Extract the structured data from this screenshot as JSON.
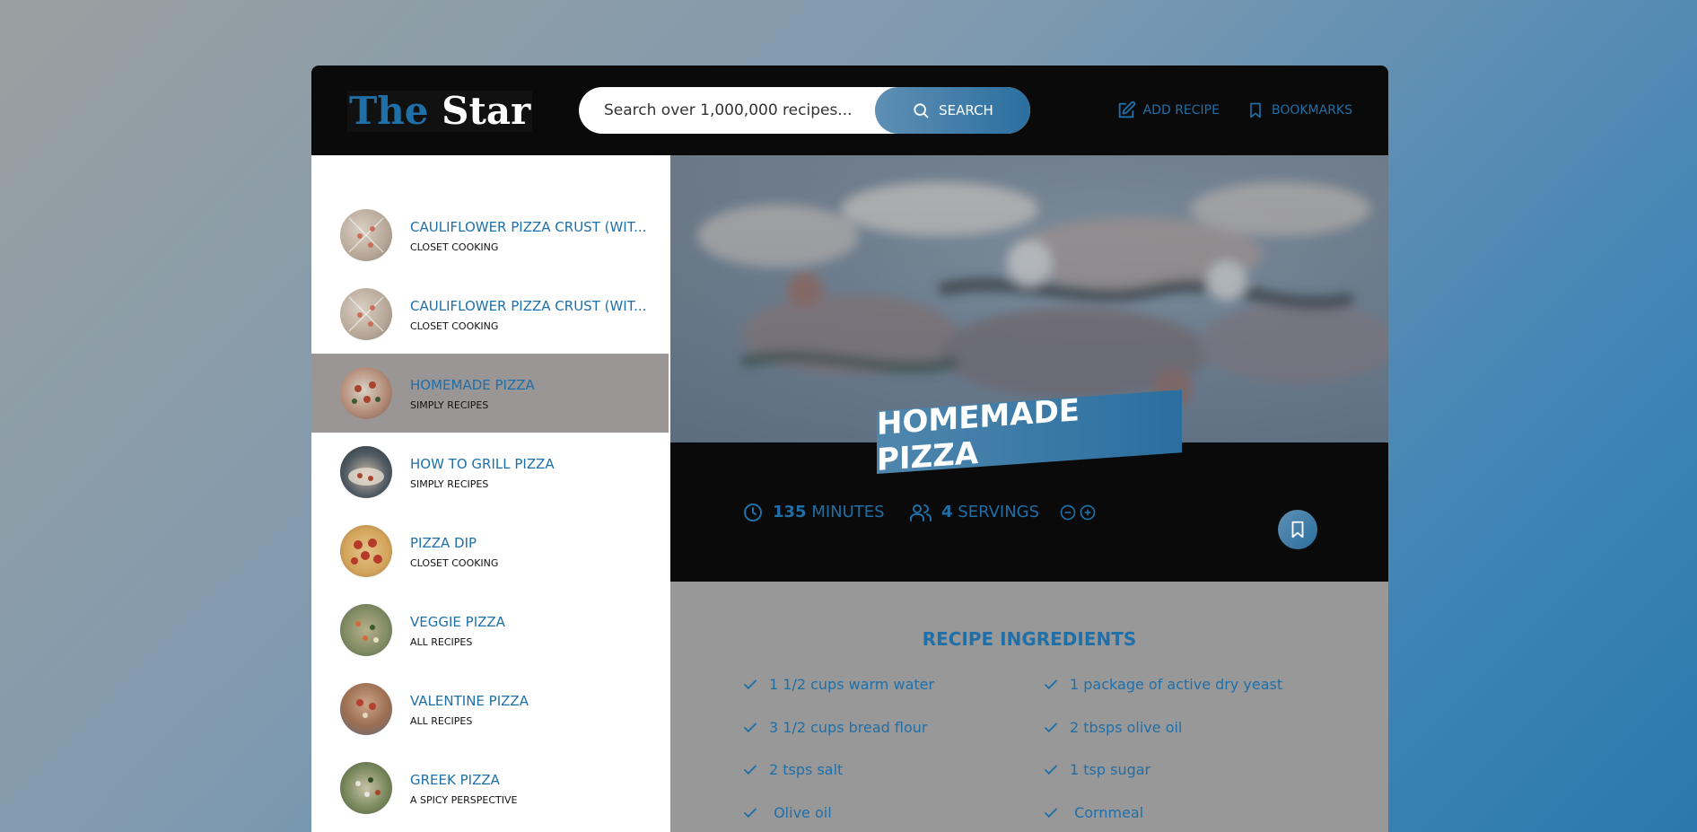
{
  "header": {
    "logo_the": "The",
    "logo_star": "Star",
    "search_placeholder": "Search over 1,000,000 recipes...",
    "search_label": "SEARCH",
    "add_recipe_label": "ADD RECIPE",
    "bookmarks_label": "BOOKMARKS"
  },
  "results": [
    {
      "title": "CAULIFLOWER PIZZA CRUST (WIT...",
      "publisher": "CLOSET COOKING",
      "active": false
    },
    {
      "title": "CAULIFLOWER PIZZA CRUST (WIT...",
      "publisher": "CLOSET COOKING",
      "active": false
    },
    {
      "title": "HOMEMADE PIZZA",
      "publisher": "SIMPLY RECIPES",
      "active": true
    },
    {
      "title": "HOW TO GRILL PIZZA",
      "publisher": "SIMPLY RECIPES",
      "active": false
    },
    {
      "title": "PIZZA DIP",
      "publisher": "CLOSET COOKING",
      "active": false
    },
    {
      "title": "VEGGIE PIZZA",
      "publisher": "ALL RECIPES",
      "active": false
    },
    {
      "title": "VALENTINE PIZZA",
      "publisher": "ALL RECIPES",
      "active": false
    },
    {
      "title": "GREEK PIZZA",
      "publisher": "A SPICY PERSPECTIVE",
      "active": false
    }
  ],
  "recipe": {
    "title": "HOMEMADE PIZZA",
    "minutes": "135",
    "minutes_label": "MINUTES",
    "servings": "4",
    "servings_label": "SERVINGS",
    "ingredients_title": "RECIPE INGREDIENTS",
    "ingredients": [
      "1 1/2 cups warm water",
      "1 package of active dry yeast",
      "3 1/2 cups bread flour",
      "2 tbsps olive oil",
      "2 tsps salt",
      "1 tsp sugar",
      " Olive oil",
      " Cornmeal"
    ]
  },
  "colors": {
    "accent": "#1f6fa8",
    "header_bg": "#0a0a0a",
    "active_result_bg": "#9a9696"
  }
}
